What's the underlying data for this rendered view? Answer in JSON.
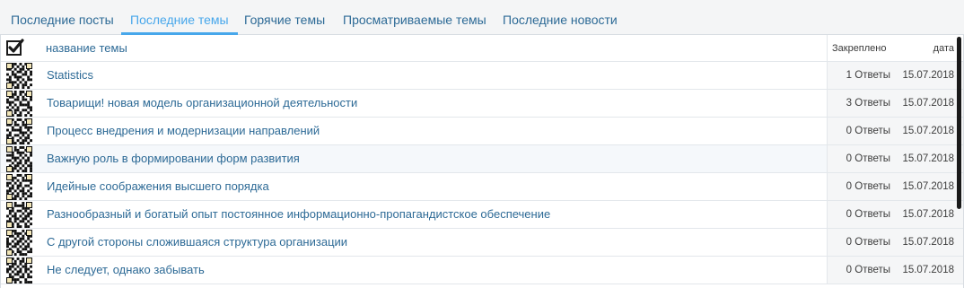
{
  "tabs": [
    {
      "label": "Последние посты",
      "active": false
    },
    {
      "label": "Последние темы",
      "active": true
    },
    {
      "label": "Горячие темы",
      "active": false
    },
    {
      "label": "Просматриваемые темы",
      "active": false
    },
    {
      "label": "Последние новости",
      "active": false
    }
  ],
  "table": {
    "header": {
      "title": "название темы",
      "pinned": "Закреплено",
      "date": "дата",
      "checkbox_icon": "checkbox-checked-icon"
    },
    "rows": [
      {
        "title": "Statistics",
        "replies": "1 Ответы",
        "date": "15.07.2018",
        "avatar_icon": "qr-avatar-icon"
      },
      {
        "title": "Товарищи! новая модель организационной деятельности",
        "replies": "3 Ответы",
        "date": "15.07.2018",
        "avatar_icon": "qr-avatar-icon"
      },
      {
        "title": "Процесс внедрения и модернизации направлений",
        "replies": "0 Ответы",
        "date": "15.07.2018",
        "avatar_icon": "qr-avatar-icon"
      },
      {
        "title": "Важную роль в формировании форм развития",
        "replies": "0 Ответы",
        "date": "15.07.2018",
        "avatar_icon": "qr-avatar-icon"
      },
      {
        "title": "Идейные соображения высшего порядка",
        "replies": "0 Ответы",
        "date": "15.07.2018",
        "avatar_icon": "qr-avatar-icon"
      },
      {
        "title": "Разнообразный и богатый опыт постоянное информационно-пропагандистское обеспечение",
        "replies": "0 Ответы",
        "date": "15.07.2018",
        "avatar_icon": "qr-avatar-icon"
      },
      {
        "title": "С другой стороны сложившаяся структура организации",
        "replies": "0 Ответы",
        "date": "15.07.2018",
        "avatar_icon": "qr-avatar-icon"
      },
      {
        "title": "Не следует, однако забывать",
        "replies": "0 Ответы",
        "date": "15.07.2018",
        "avatar_icon": "qr-avatar-icon"
      }
    ]
  },
  "colors": {
    "link": "#2d6a96",
    "active_tab": "#47a7eb",
    "text": "#3b3b3b"
  }
}
